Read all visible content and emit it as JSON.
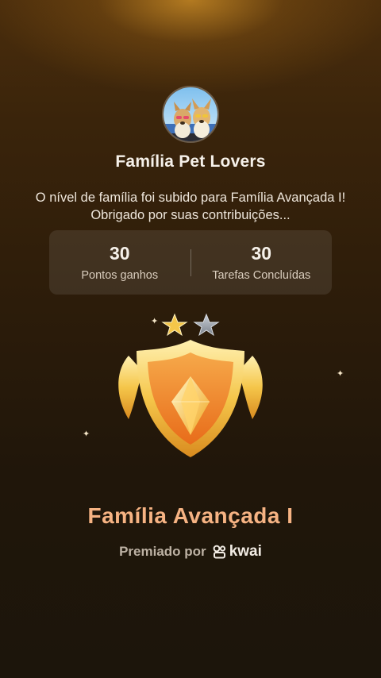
{
  "group": {
    "name": "Família Pet Lovers",
    "avatar_icon": "dogs-avatar-icon"
  },
  "message": "O nível de família foi subido para Família Avançada I! Obrigado por suas contribuições...",
  "stats": [
    {
      "value": "30",
      "label": "Pontos ganhos"
    },
    {
      "value": "30",
      "label": "Tarefas Concluídas"
    }
  ],
  "badge": {
    "stars_filled": 1,
    "stars_total": 2,
    "colors": {
      "gold": "#f5c64a",
      "orange": "#f29a2e",
      "silver": "#9aa1aa"
    }
  },
  "level_name": "Família Avançada I",
  "awarded": {
    "prefix": "Premiado por",
    "brand": "kwai"
  }
}
